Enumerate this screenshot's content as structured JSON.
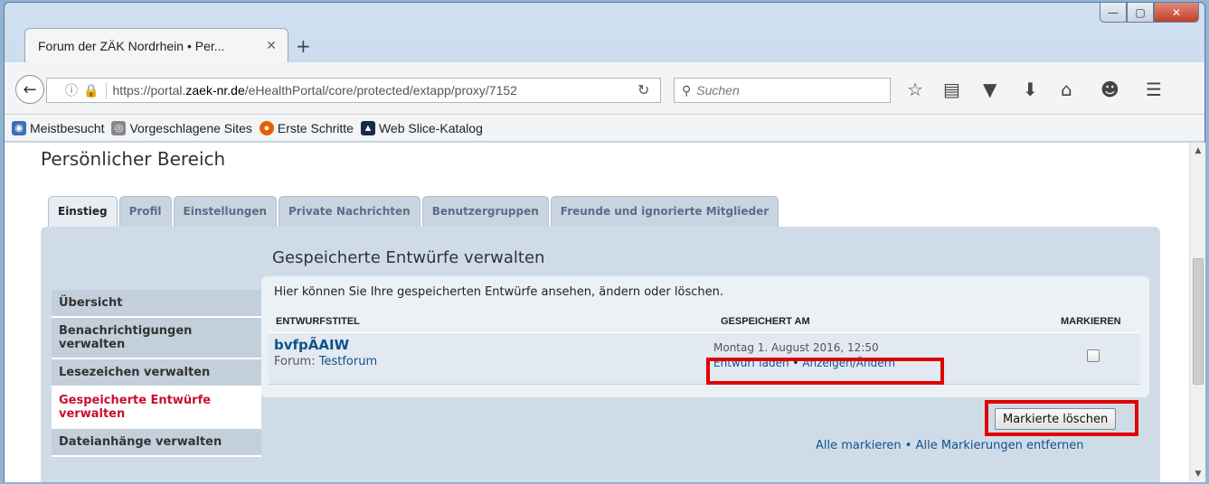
{
  "browser": {
    "tab_title": "Forum der ZÄK Nordrhein • Per...",
    "tab_close": "✕",
    "new_tab": "+",
    "window_controls": {
      "minimize": "—",
      "maximize": "▢",
      "close": "✕"
    },
    "url_prefix": "https://portal.",
    "url_domain": "zaek-nr.de",
    "url_path": "/eHealthPortal/core/protected/extapp/proxy/7152",
    "search_placeholder": "Suchen",
    "bookmarks": [
      {
        "label": "Meistbesucht",
        "icon": "bookmark-folder-icon"
      },
      {
        "label": "Vorgeschlagene Sites",
        "icon": "globe-icon"
      },
      {
        "label": "Erste Schritte",
        "icon": "firefox-icon"
      },
      {
        "label": "Web Slice-Katalog",
        "icon": "web-slice-icon"
      }
    ]
  },
  "page": {
    "title": "Persönlicher Bereich",
    "tabs": [
      "Einstieg",
      "Profil",
      "Einstellungen",
      "Private Nachrichten",
      "Benutzergruppen",
      "Freunde und ignorierte Mitglieder"
    ],
    "active_tab": "Einstieg",
    "sidenav": [
      {
        "label": "Übersicht"
      },
      {
        "label": "Benachrichtigungen verwalten"
      },
      {
        "label": "Lesezeichen verwalten"
      },
      {
        "label": "Gespeicherte Entwürfe verwalten"
      },
      {
        "label": "Dateianhänge verwalten"
      }
    ],
    "active_sidenav": "Gespeicherte Entwürfe verwalten",
    "section_title": "Gespeicherte Entwürfe verwalten",
    "description": "Hier können Sie Ihre gespeicherten Entwürfe ansehen, ändern oder löschen.",
    "columns": {
      "title": "ENTWURFSTITEL",
      "saved": "GESPEICHERT AM",
      "mark": "MARKIEREN"
    },
    "drafts": [
      {
        "title": "bvfpÃAIW",
        "forum_prefix": "Forum:",
        "forum": "Testforum",
        "date": "Montag 1. August 2016, 12:50",
        "load_link": "Entwurf laden",
        "edit_link": "Anzeigen/Ändern",
        "link_sep": "•"
      }
    ],
    "delete_button": "Markierte löschen",
    "mark_all": "Alle markieren",
    "unmark_all": "Alle Markierungen entfernen",
    "mark_sep": "•"
  },
  "colors": {
    "highlight": "#e00000",
    "link": "#105289",
    "active_nav": "#c8102e"
  }
}
